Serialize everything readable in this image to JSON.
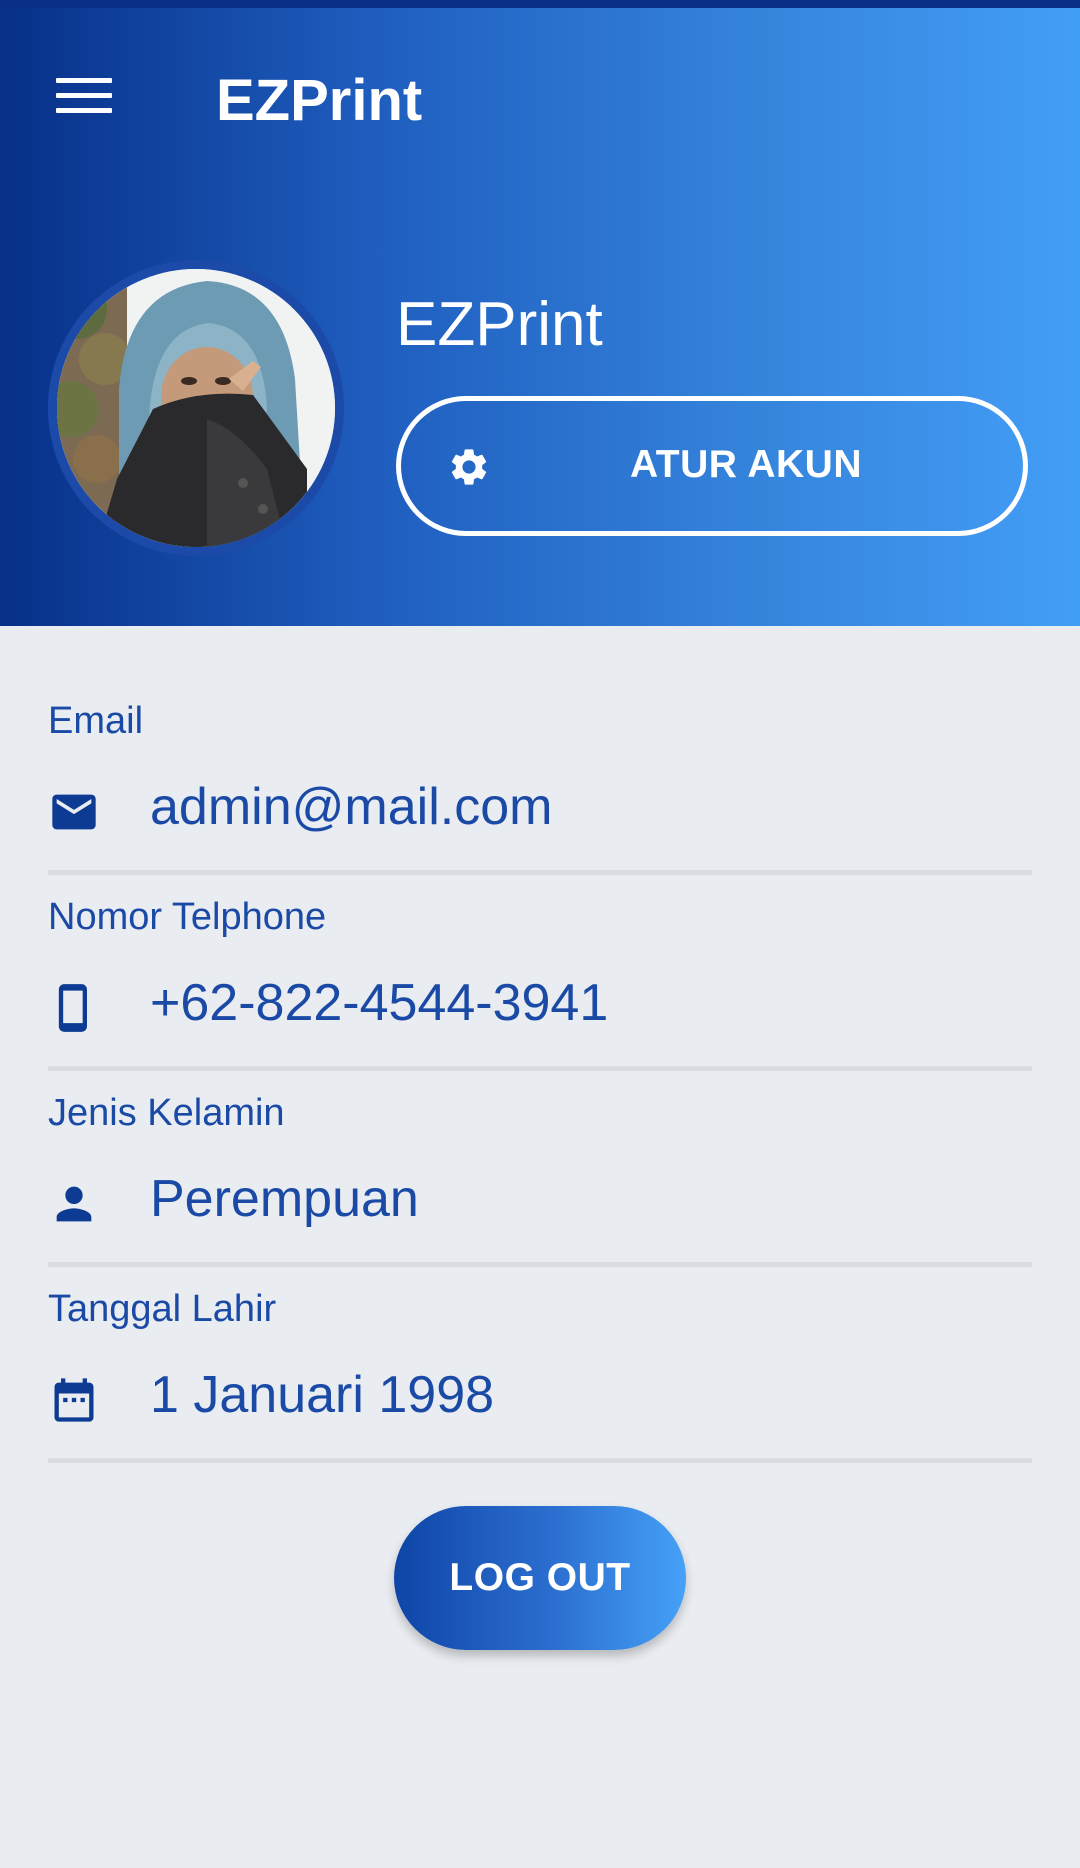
{
  "app": {
    "title": "EZPrint"
  },
  "profile": {
    "name": "EZPrint",
    "settings_button_label": "ATUR AKUN"
  },
  "fields": [
    {
      "label": "Email",
      "value": "admin@mail.com",
      "icon": "email-icon"
    },
    {
      "label": "Nomor Telphone",
      "value": "+62-822-4544-3941",
      "icon": "phone-icon"
    },
    {
      "label": "Jenis Kelamin",
      "value": "Perempuan",
      "icon": "person-icon"
    },
    {
      "label": "Tanggal Lahir",
      "value": "1 Januari 1998",
      "icon": "calendar-icon"
    }
  ],
  "logout": {
    "label": "LOG OUT"
  },
  "colors": {
    "header_gradient_start": "#073088",
    "header_gradient_end": "#439ef6",
    "text_blue": "#1a4aa6",
    "background": "#e9ecf0"
  }
}
